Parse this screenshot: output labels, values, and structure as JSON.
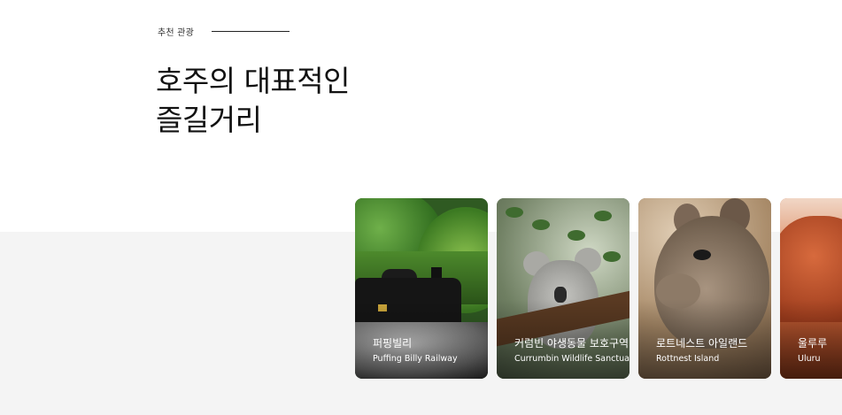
{
  "section": {
    "eyebrow": "추천 관광",
    "title_line1": "호주의 대표적인",
    "title_line2": "즐길거리"
  },
  "cards": [
    {
      "title_ko": "퍼핑빌리",
      "title_en": "Puffing Billy Railway"
    },
    {
      "title_ko": "커럼빈 야생동물 보호구역",
      "title_en": "Currumbin Wildlife Sanctuary"
    },
    {
      "title_ko": "로트네스트 아일랜드",
      "title_en": "Rottnest Island"
    },
    {
      "title_ko": "울루루",
      "title_en": "Uluru"
    }
  ],
  "colors": {
    "band": "#f4f4f4",
    "text": "#111111",
    "card_text": "#ffffff"
  }
}
